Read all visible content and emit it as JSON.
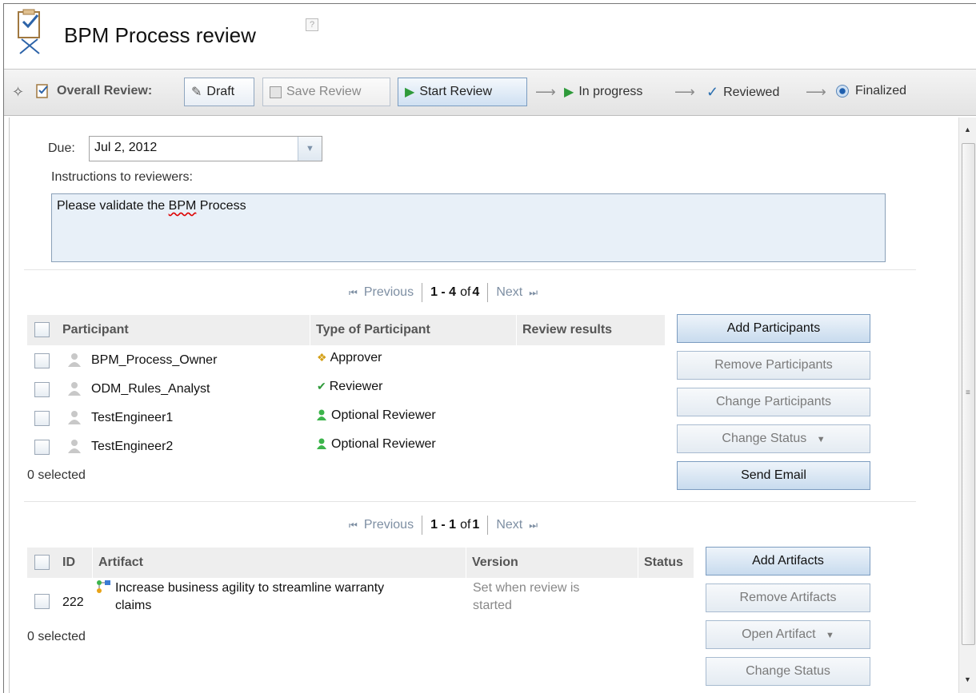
{
  "header": {
    "title": "BPM Process review",
    "help_icon": "?"
  },
  "toolbar": {
    "overall_review_label": "Overall Review:",
    "draft_label": "Draft",
    "save_label": "Save Review",
    "start_label": "Start Review",
    "steps": [
      "In progress",
      "Reviewed",
      "Finalized"
    ]
  },
  "form": {
    "due_label": "Due:",
    "due_value": "Jul 2, 2012",
    "instructions_label": "Instructions to reviewers:",
    "instructions_before": "Please validate the ",
    "instructions_mid": "BPM",
    "instructions_after": " Process"
  },
  "participants": {
    "pager": {
      "prev": "Previous",
      "range": "1 - 4",
      "of": "of",
      "total": "4",
      "next": "Next"
    },
    "columns": [
      "Participant",
      "Type of Participant",
      "Review results"
    ],
    "rows": [
      {
        "name": "BPM_Process_Owner",
        "type": "Approver",
        "icon": "approver-icon"
      },
      {
        "name": "ODM_Rules_Analyst",
        "type": "Reviewer",
        "icon": "reviewer-icon"
      },
      {
        "name": "TestEngineer1",
        "type": "Optional Reviewer",
        "icon": "optional-reviewer-icon"
      },
      {
        "name": "TestEngineer2",
        "type": "Optional Reviewer",
        "icon": "optional-reviewer-icon"
      }
    ],
    "selected": "0 selected",
    "buttons": [
      "Add Participants",
      "Remove Participants",
      "Change Participants",
      "Change Status",
      "Send Email"
    ]
  },
  "artifacts": {
    "pager": {
      "prev": "Previous",
      "range": "1 - 1",
      "of": "of",
      "total": "1",
      "next": "Next"
    },
    "columns": [
      "ID",
      "Artifact",
      "Version",
      "Status"
    ],
    "rows": [
      {
        "id": "222",
        "name_line1": "Increase business agility to streamline warranty",
        "name_line2": "claims",
        "version_line1": "Set when review is",
        "version_line2": "started",
        "status": ""
      }
    ],
    "selected": "0 selected",
    "buttons": [
      "Add Artifacts",
      "Remove Artifacts",
      "Open Artifact",
      "Change Status"
    ]
  },
  "colors": {
    "link": "#2d6ea6",
    "accent_green": "#2e9a3a",
    "header_gray": "#eeeeee"
  }
}
